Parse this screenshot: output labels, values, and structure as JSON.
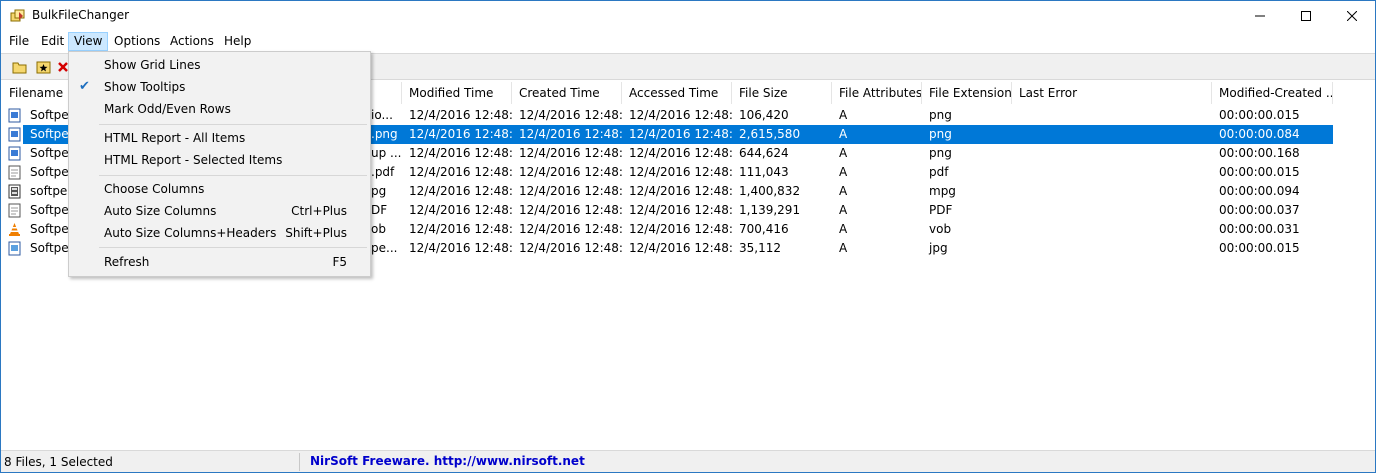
{
  "window": {
    "title": "BulkFileChanger",
    "minimize_glyph": "—",
    "maximize_glyph": "☐",
    "close_glyph": "✕"
  },
  "menubar": [
    {
      "label": "File"
    },
    {
      "label": "Edit"
    },
    {
      "label": "View"
    },
    {
      "label": "Options"
    },
    {
      "label": "Actions"
    },
    {
      "label": "Help"
    }
  ],
  "toolbar": {
    "icons": [
      "open-folder-icon",
      "add-files-icon",
      "remove-icon"
    ]
  },
  "columns": [
    {
      "label": "Filename"
    },
    {
      "label": ""
    },
    {
      "label": "Modified Time"
    },
    {
      "label": "Created Time"
    },
    {
      "label": "Accessed Time"
    },
    {
      "label": "File Size"
    },
    {
      "label": "File Attributes"
    },
    {
      "label": "File Extension"
    },
    {
      "label": "Last Error"
    },
    {
      "label": "Modified-Created ..."
    }
  ],
  "rows": [
    {
      "name": "Softpedi",
      "path": "io...",
      "modified": "12/4/2016 12:48:...",
      "created": "12/4/2016 12:48:...",
      "accessed": "12/4/2016 12:48:...",
      "size": "106,420",
      "attr": "A",
      "ext": "png",
      "error": "",
      "diff": "00:00:00.015",
      "icon": "png-file-icon"
    },
    {
      "name": "Softpedi",
      "path": ".png",
      "modified": "12/4/2016 12:48:...",
      "created": "12/4/2016 12:48:...",
      "accessed": "12/4/2016 12:48:...",
      "size": "2,615,580",
      "attr": "A",
      "ext": "png",
      "error": "",
      "diff": "00:00:00.084",
      "icon": "png-file-icon",
      "selected": true
    },
    {
      "name": "Softpedi",
      "path": "up ...",
      "modified": "12/4/2016 12:48:...",
      "created": "12/4/2016 12:48:...",
      "accessed": "12/4/2016 12:48:...",
      "size": "644,624",
      "attr": "A",
      "ext": "png",
      "error": "",
      "diff": "00:00:00.168",
      "icon": "png-file-icon"
    },
    {
      "name": "Softpedi",
      "path": ".pdf",
      "modified": "12/4/2016 12:48:...",
      "created": "12/4/2016 12:48:...",
      "accessed": "12/4/2016 12:48:...",
      "size": "111,043",
      "attr": "A",
      "ext": "pdf",
      "error": "",
      "diff": "00:00:00.015",
      "icon": "pdf-file-icon"
    },
    {
      "name": "softpedi",
      "path": "pg",
      "modified": "12/4/2016 12:48:...",
      "created": "12/4/2016 12:48:...",
      "accessed": "12/4/2016 12:48:...",
      "size": "1,400,832",
      "attr": "A",
      "ext": "mpg",
      "error": "",
      "diff": "00:00:00.094",
      "icon": "video-file-icon"
    },
    {
      "name": "Softpedi",
      "path": "DF",
      "modified": "12/4/2016 12:48:...",
      "created": "12/4/2016 12:48:...",
      "accessed": "12/4/2016 12:48:...",
      "size": "1,139,291",
      "attr": "A",
      "ext": "PDF",
      "error": "",
      "diff": "00:00:00.037",
      "icon": "pdf-file-icon"
    },
    {
      "name": "Softpedi",
      "path": "ob",
      "modified": "12/4/2016 12:48:...",
      "created": "12/4/2016 12:48:...",
      "accessed": "12/4/2016 12:48:...",
      "size": "700,416",
      "attr": "A",
      "ext": "vob",
      "error": "",
      "diff": "00:00:00.031",
      "icon": "vlc-cone-icon"
    },
    {
      "name": "Softpedi",
      "path": "pe...",
      "modified": "12/4/2016 12:48:...",
      "created": "12/4/2016 12:48:...",
      "accessed": "12/4/2016 12:48:...",
      "size": "35,112",
      "attr": "A",
      "ext": "jpg",
      "error": "",
      "diff": "00:00:00.015",
      "icon": "image-file-icon"
    }
  ],
  "view_menu": {
    "show_grid_lines": "Show Grid Lines",
    "show_tooltips": "Show Tooltips",
    "mark_odd_even": "Mark Odd/Even Rows",
    "html_report_all": "HTML Report - All Items",
    "html_report_selected": "HTML Report - Selected Items",
    "choose_columns": "Choose Columns",
    "auto_size_columns": "Auto Size Columns",
    "auto_size_columns_shortcut": "Ctrl+Plus",
    "auto_size_columns_headers": "Auto Size Columns+Headers",
    "auto_size_columns_headers_shortcut": "Shift+Plus",
    "refresh": "Refresh",
    "refresh_shortcut": "F5",
    "check_glyph": "✔"
  },
  "status": {
    "left": "8 Files, 1 Selected",
    "right": "NirSoft Freeware.  http://www.nirsoft.net"
  },
  "colors": {
    "selection": "#0078d7",
    "menu_active": "#cce8ff",
    "link_blue": "#0000cc"
  }
}
